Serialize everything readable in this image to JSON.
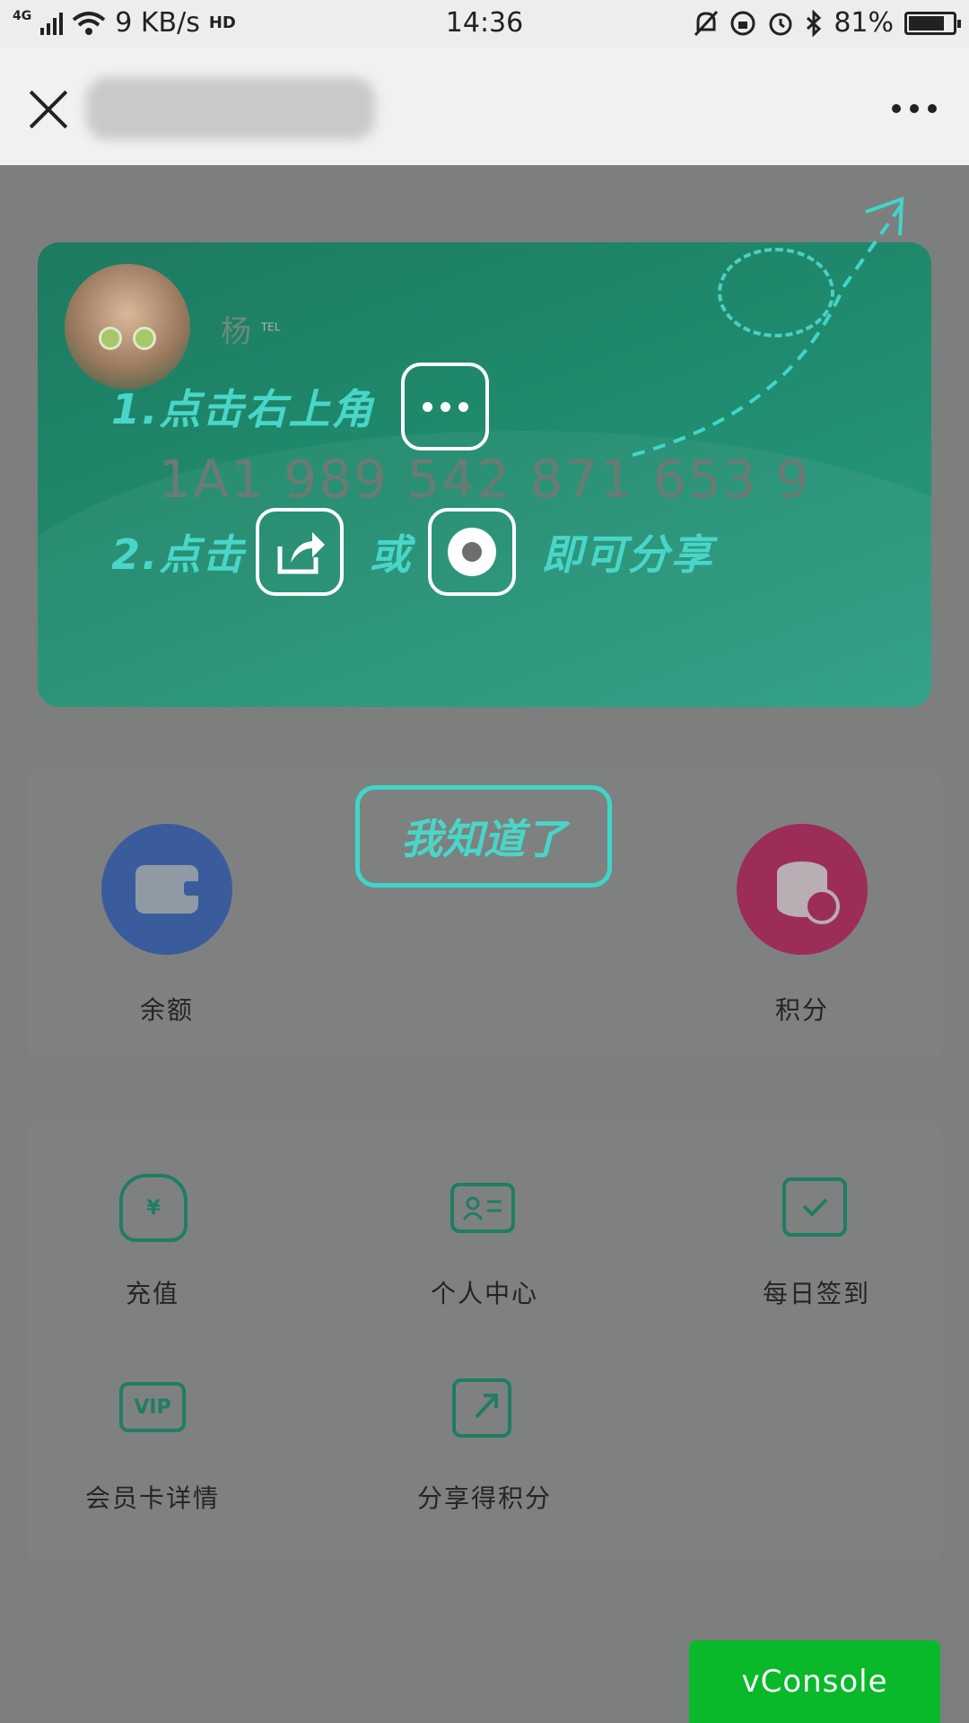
{
  "status_bar": {
    "network": "4G",
    "speed": "9 KB/s",
    "hd": "HD",
    "time": "14:36",
    "battery": "81%",
    "battery_level": 0.81
  },
  "nav": {
    "title": ""
  },
  "card": {
    "name": "杨",
    "tel_badge": "TEL",
    "number": "1A1 989 542 871 653 9"
  },
  "guide": {
    "step1": "1.点击右上角",
    "step2_prefix": "2.点击",
    "step2_or": "或",
    "step2_suffix": "即可分享",
    "dismiss": "我知道了"
  },
  "balances": [
    {
      "label": "余额",
      "icon": "wallet-icon"
    },
    {
      "label": "积分",
      "icon": "points-icon"
    }
  ],
  "menu": [
    {
      "label": "充值",
      "icon": "money-bag-icon"
    },
    {
      "label": "个人中心",
      "icon": "id-card-icon"
    },
    {
      "label": "每日签到",
      "icon": "calendar-check-icon"
    },
    {
      "label": "会员卡详情",
      "icon": "vip-card-icon",
      "glyph": "VIP"
    },
    {
      "label": "分享得积分",
      "icon": "share-external-icon"
    }
  ],
  "vconsole": "vConsole",
  "colors": {
    "accent_teal": "#49d6c8",
    "card_green": "#1f8a6d",
    "vconsole_green": "#09b92a"
  }
}
